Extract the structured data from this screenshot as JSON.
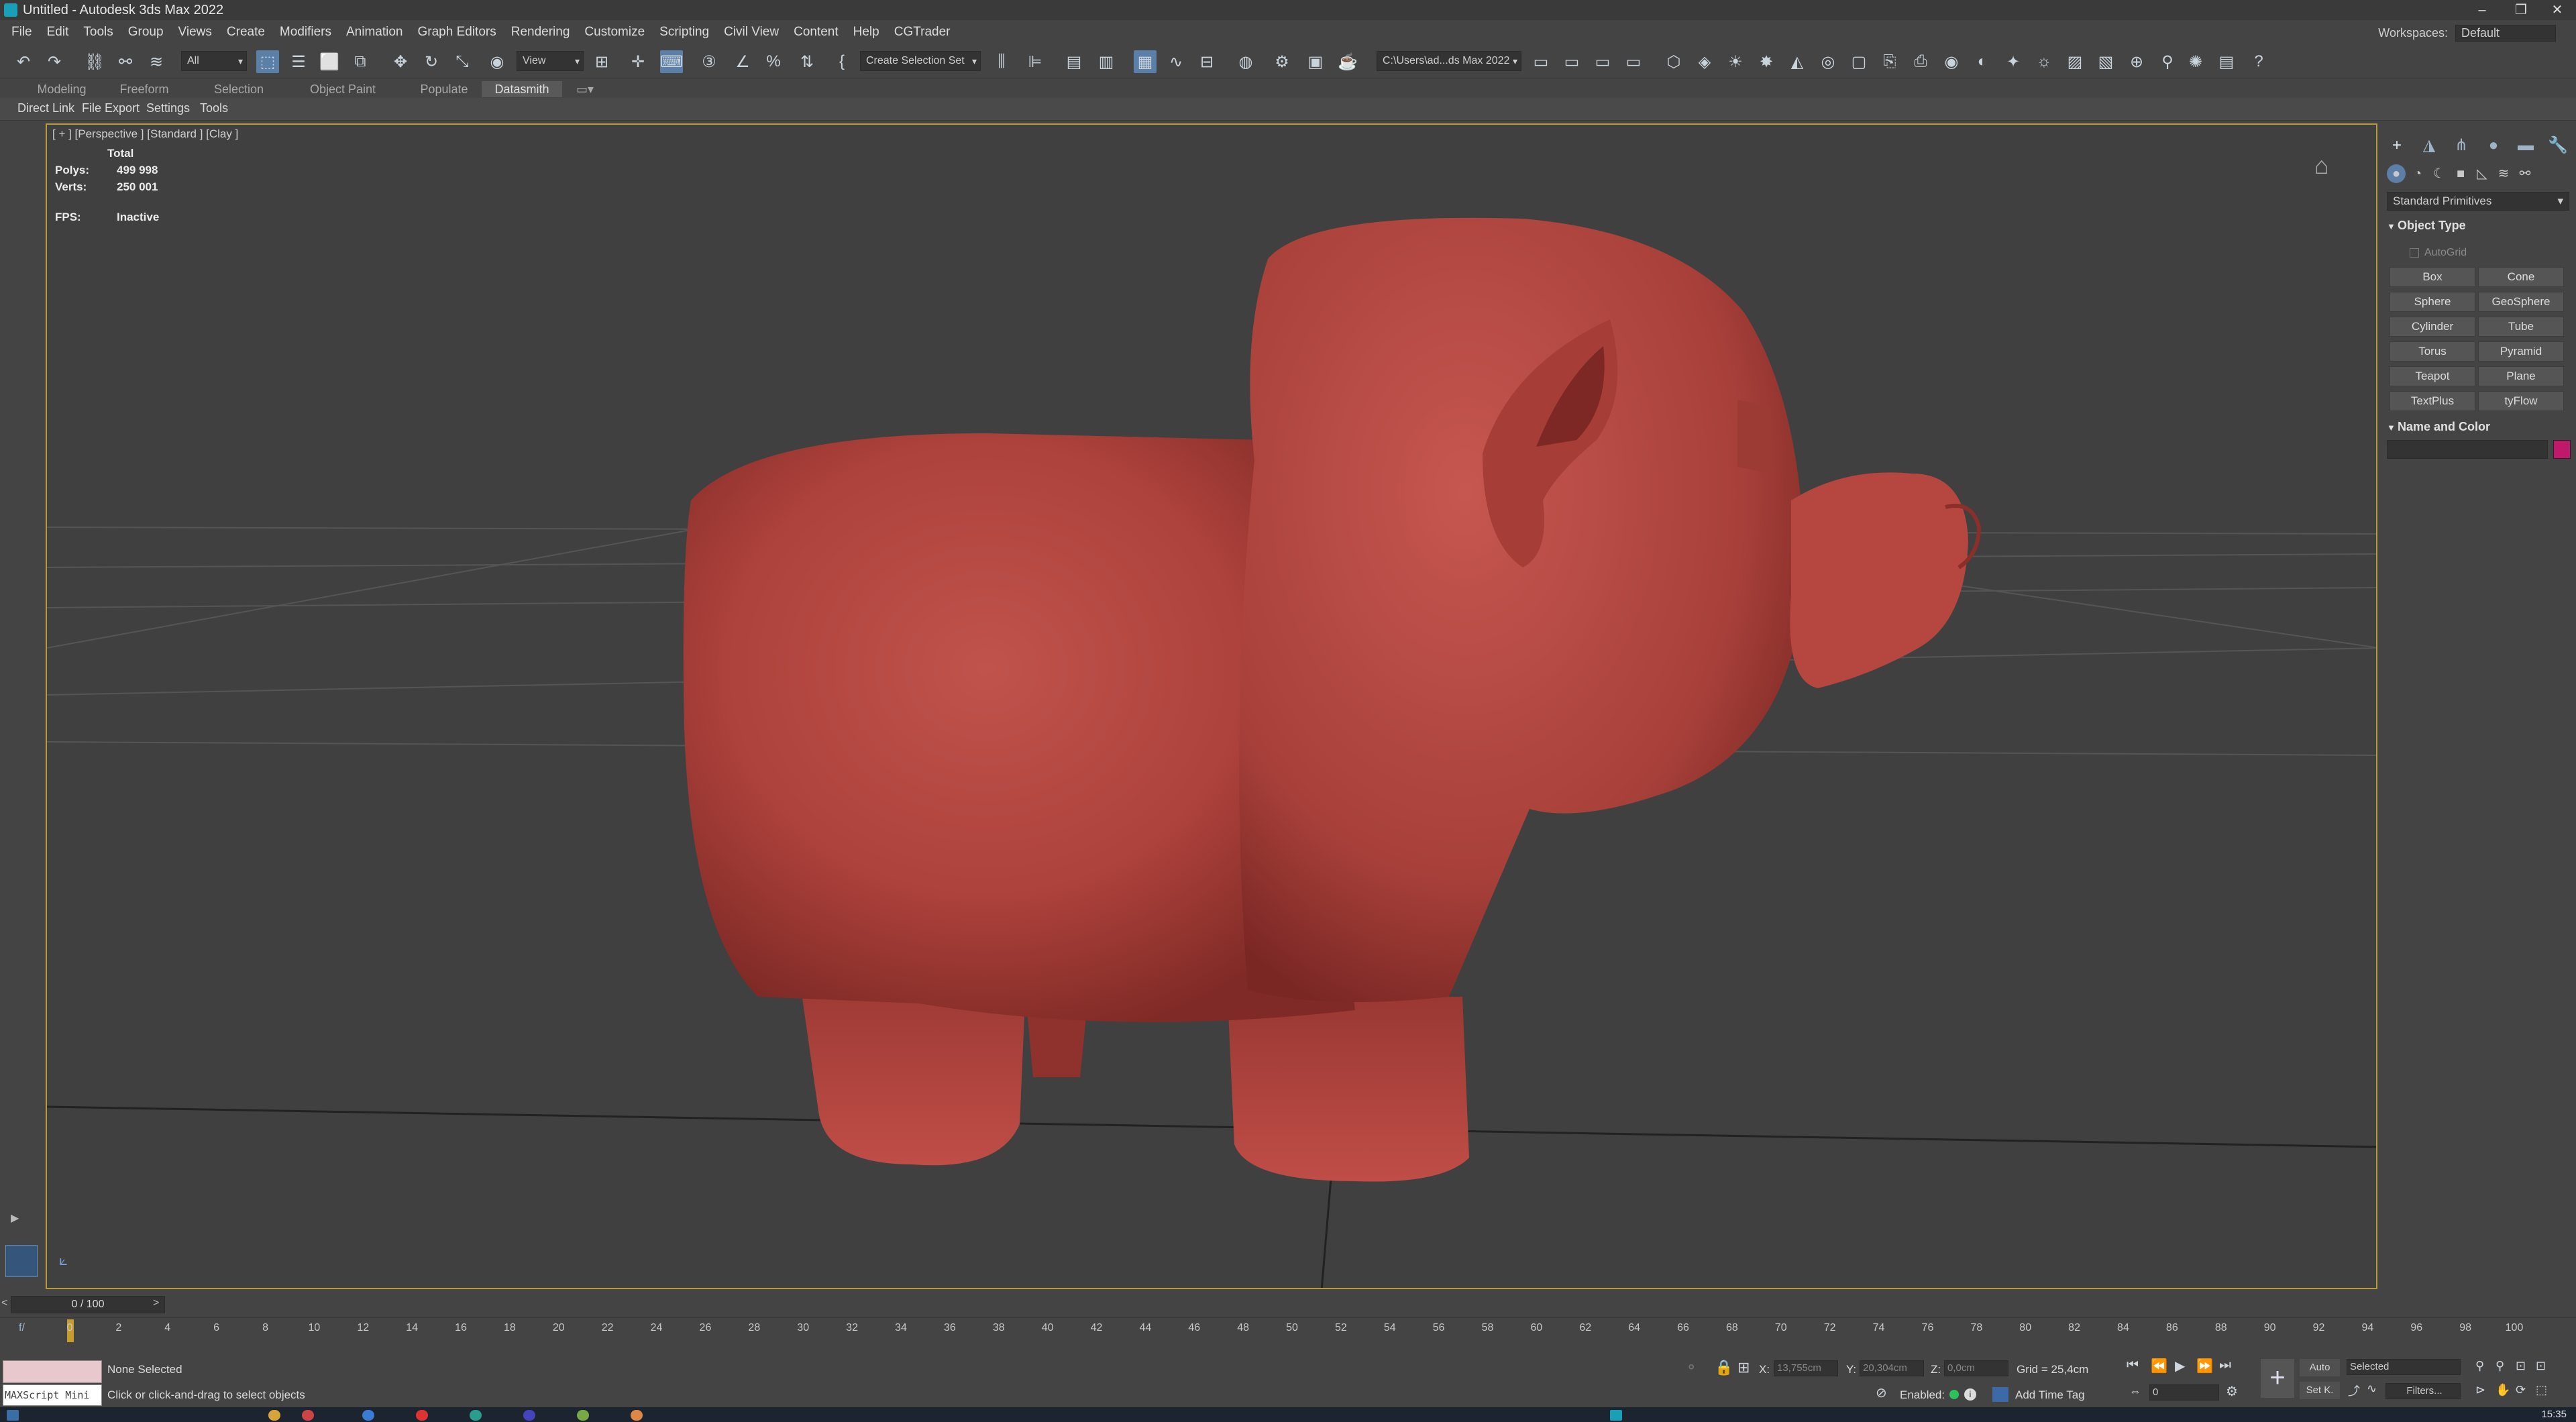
{
  "window": {
    "title": "Untitled - Autodesk 3ds Max 2022",
    "controls": [
      "–",
      "❐",
      "✕"
    ]
  },
  "menu": {
    "items": [
      "File",
      "Edit",
      "Tools",
      "Group",
      "Views",
      "Create",
      "Modifiers",
      "Animation",
      "Graph Editors",
      "Rendering",
      "Customize",
      "Scripting",
      "Civil View",
      "Content",
      "Help",
      "CGTrader"
    ],
    "workspaces_label": "Workspaces:",
    "workspaces_value": "Default"
  },
  "toolbar": {
    "filter_all": "All",
    "ref_coord": "View",
    "selection_set": "Create Selection Set",
    "project_path": "C:\\Users\\ad...ds Max 2022"
  },
  "ribbon": {
    "tabs": [
      "Modeling",
      "Freeform",
      "Selection",
      "Object Paint",
      "Populate",
      "Datasmith"
    ],
    "active_tab": "Datasmith",
    "subtabs": [
      "Direct Link",
      "File Export",
      "Settings",
      "Tools"
    ]
  },
  "viewport": {
    "label": "[ + ] [Perspective ] [Standard ] [Clay ]",
    "stats": {
      "total_label": "Total",
      "polys_label": "Polys:",
      "polys_value": "499 998",
      "verts_label": "Verts:",
      "verts_value": "250 001",
      "fps_label": "FPS:",
      "fps_value": "Inactive"
    },
    "model_color": "#b6403a"
  },
  "command_panel": {
    "dropdown": "Standard Primitives",
    "object_type_title": "Object Type",
    "autogrid": "AutoGrid",
    "primitives": [
      "Box",
      "Cone",
      "Sphere",
      "GeoSphere",
      "Cylinder",
      "Tube",
      "Torus",
      "Pyramid",
      "Teapot",
      "Plane",
      "TextPlus",
      "tyFlow"
    ],
    "name_color_title": "Name and Color",
    "swatch_color": "#c0186a"
  },
  "timeline": {
    "frame_display": "0 / 100",
    "ticks": [
      "0",
      "2",
      "4",
      "6",
      "8",
      "10",
      "12",
      "14",
      "16",
      "18",
      "20",
      "22",
      "24",
      "26",
      "28",
      "30",
      "32",
      "34",
      "36",
      "38",
      "40",
      "42",
      "44",
      "46",
      "48",
      "50",
      "52",
      "54",
      "56",
      "58",
      "60",
      "62",
      "64",
      "66",
      "68",
      "70",
      "72",
      "74",
      "76",
      "78",
      "80",
      "82",
      "84",
      "86",
      "88",
      "90",
      "92",
      "94",
      "96",
      "98",
      "100"
    ]
  },
  "status": {
    "maxscript": "MAXScript Mini",
    "selection": "None Selected",
    "prompt": "Click or click-and-drag to select objects",
    "x_label": "X:",
    "x_value": "13,755cm",
    "y_label": "Y:",
    "y_value": "20,304cm",
    "z_label": "Z:",
    "z_value": "0,0cm",
    "grid": "Grid = 25,4cm",
    "enabled_label": "Enabled:",
    "add_time_tag": "Add Time Tag",
    "auto": "Auto",
    "set_key": "Set K.",
    "key_mode": "Selected",
    "filters": "Filters...",
    "frame_value": "0"
  },
  "taskbar": {
    "clock": "15:35"
  }
}
